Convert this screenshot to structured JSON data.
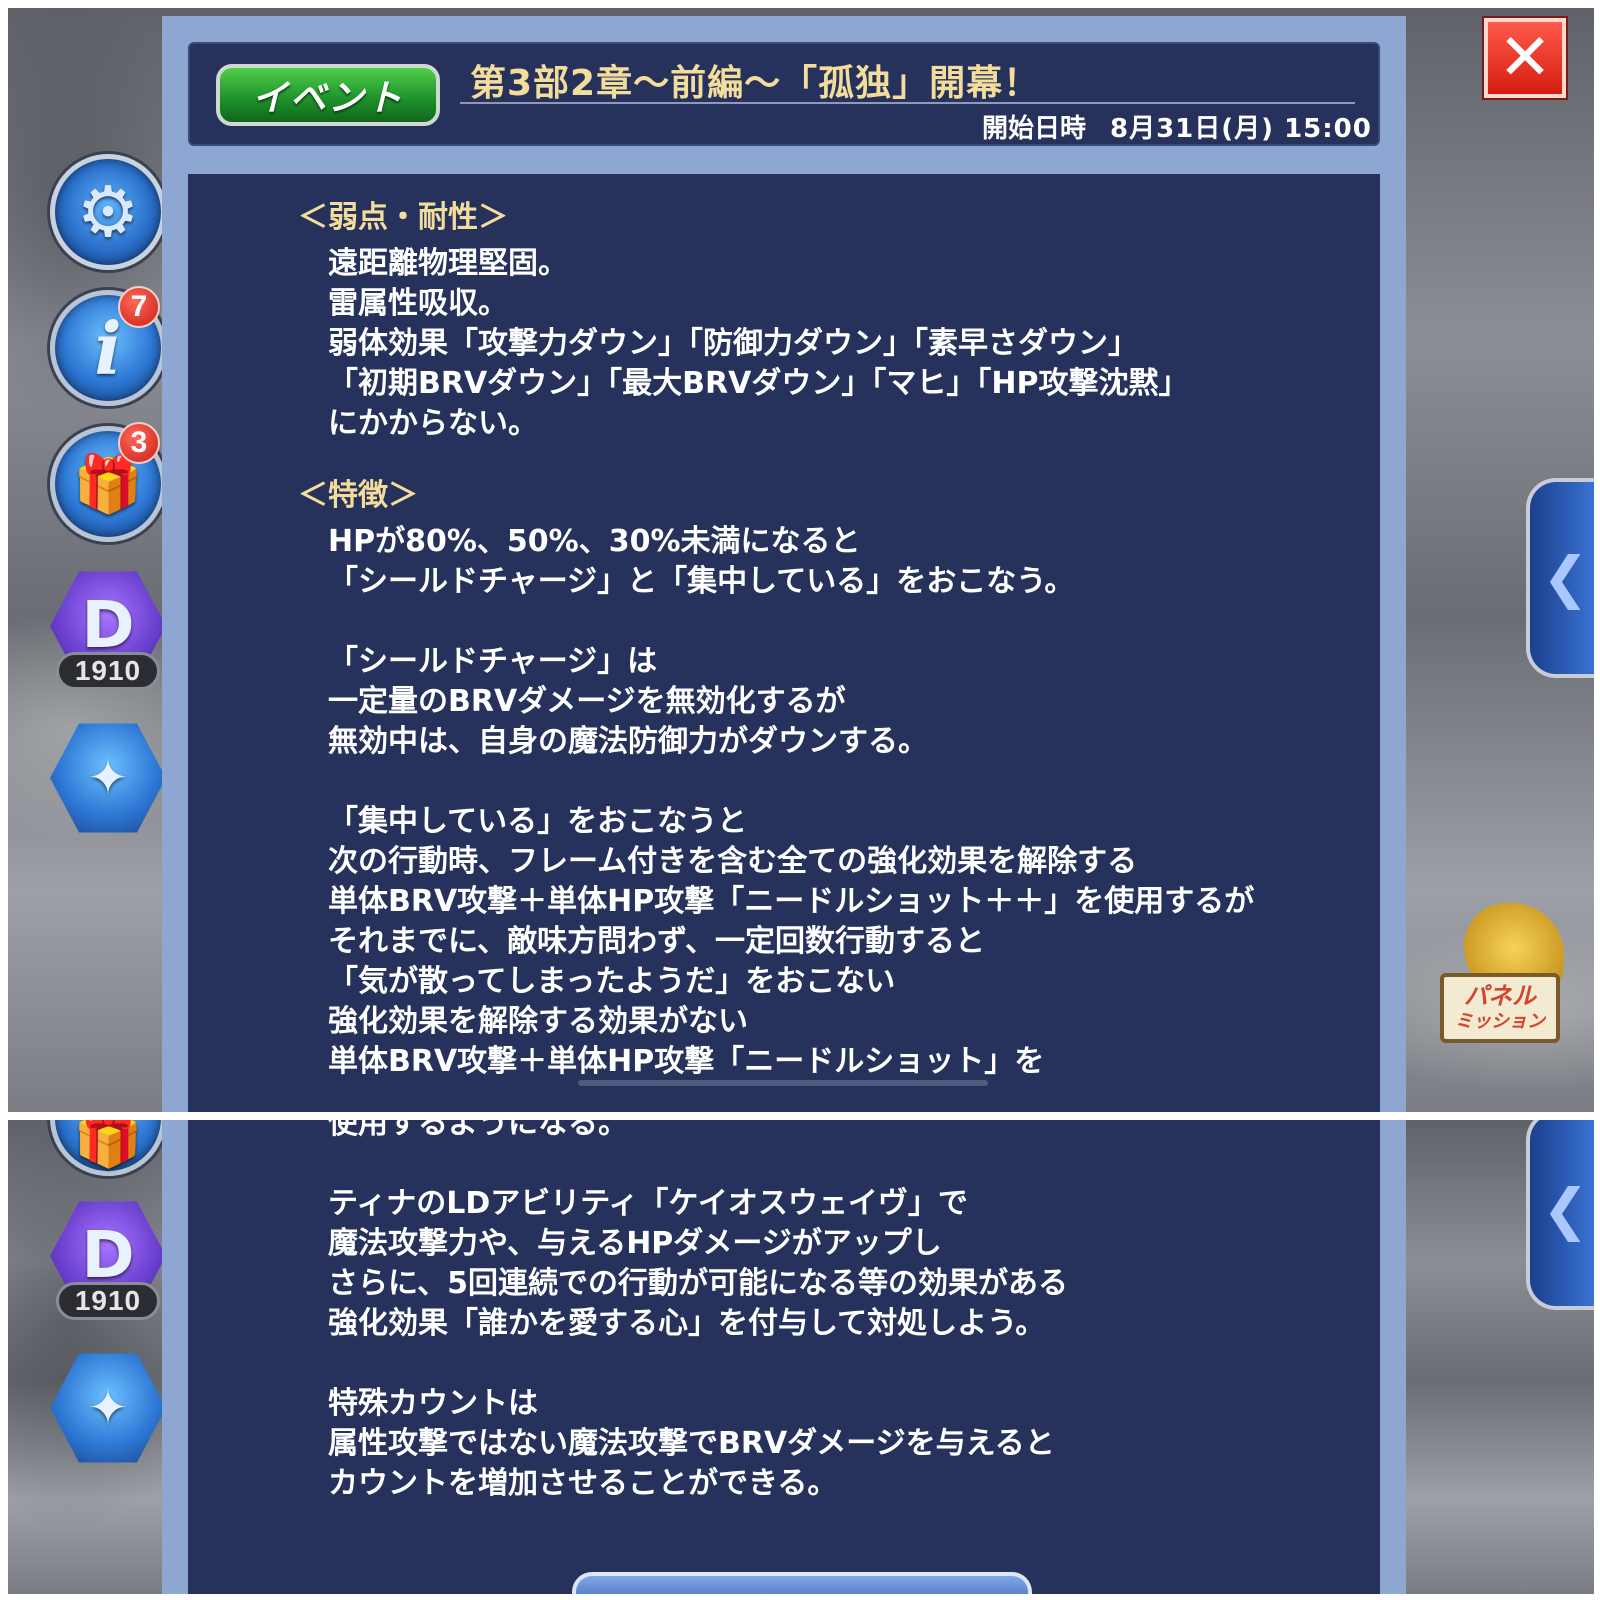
{
  "header": {
    "badge": "イベント",
    "title": "第3部2章～前編～「孤独」開幕！",
    "start_label": "開始日時",
    "start_date": "8月31日(月) 15:00"
  },
  "sidebar": {
    "info_badge": "7",
    "gift_badge": "3",
    "counter": "1910",
    "info_glyph": "i",
    "gear_glyph": "⚙",
    "gift_glyph": "🎁"
  },
  "close_label": "✕",
  "right": {
    "chevron": "❮",
    "mission_line1": "パネル",
    "mission_line2": "ミッション"
  },
  "sections": {
    "weak_head": "＜弱点・耐性＞",
    "weak_lines": [
      "遠距離物理堅固。",
      "雷属性吸収。",
      "弱体効果「攻撃力ダウン」「防御力ダウン」「素早さダウン」",
      "「初期BRVダウン」「最大BRVダウン」「マヒ」「HP攻撃沈黙」",
      "にかからない。"
    ],
    "feat_head": "＜特徴＞",
    "feat_lines_top": [
      "HPが80%、50%、30%未満になると",
      "「シールドチャージ」と「集中している」をおこなう。",
      "「シールドチャージ」は",
      "一定量のBRVダメージを無効化するが",
      "無効中は、自身の魔法防御力がダウンする。",
      "「集中している」をおこなうと",
      "次の行動時、フレーム付きを含む全ての強化効果を解除する",
      "単体BRV攻撃＋単体HP攻撃「ニードルショット＋＋」を使用するが",
      "それまでに、敵味方問わず、一定回数行動すると",
      "「気が散ってしまったようだ」をおこない",
      "強化効果を解除する効果がない",
      "単体BRV攻撃＋単体HP攻撃「ニードルショット」を"
    ],
    "feat_lines_bottom": [
      "使用するようになる。",
      "ティナのLDアビリティ「ケイオスウェイヴ」で",
      "魔法攻撃力や、与えるHPダメージがアップし",
      "さらに、5回連続での行動が可能になる等の効果がある",
      "強化効果「誰かを愛する心」を付与して対処しよう。",
      "特殊カウントは",
      "属性攻撃ではない魔法攻撃でBRVダメージを与えると",
      "カウントを増加させることができる。"
    ]
  }
}
